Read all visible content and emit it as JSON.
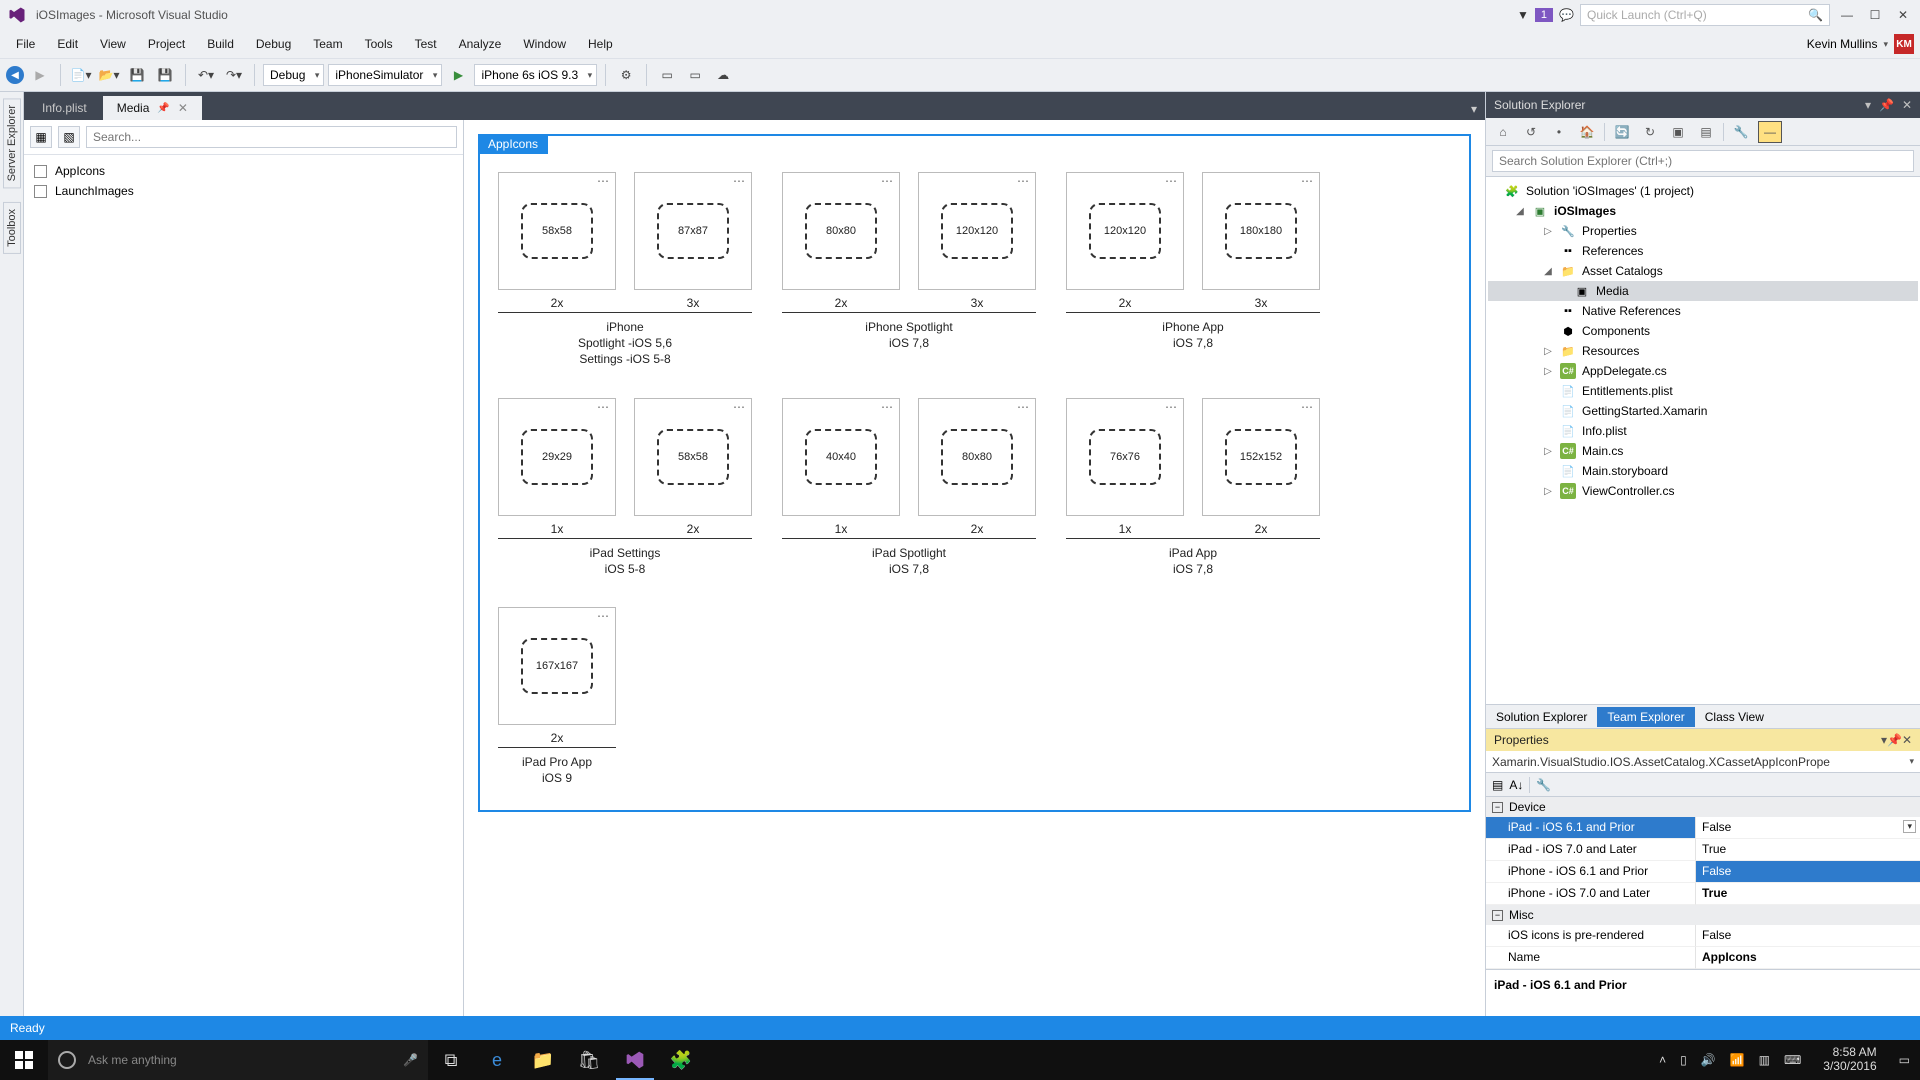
{
  "titlebar": {
    "title": "iOSImages - Microsoft Visual Studio",
    "badge": "1",
    "quick_launch": "Quick Launch (Ctrl+Q)"
  },
  "menubar": {
    "items": [
      "File",
      "Edit",
      "View",
      "Project",
      "Build",
      "Debug",
      "Team",
      "Tools",
      "Test",
      "Analyze",
      "Window",
      "Help"
    ],
    "user": "Kevin Mullins",
    "initials": "KM"
  },
  "toolbar": {
    "config": "Debug",
    "platform": "iPhoneSimulator",
    "target": "iPhone 6s iOS 9.3"
  },
  "doc_tabs": [
    {
      "label": "Info.plist",
      "active": false
    },
    {
      "label": "Media",
      "active": true
    }
  ],
  "asset_left": {
    "search_placeholder": "Search...",
    "items": [
      {
        "label": "AppIcons"
      },
      {
        "label": "LaunchImages"
      }
    ]
  },
  "asset_card": {
    "tag": "AppIcons",
    "groups": [
      {
        "caption": "iPhone\nSpotlight -iOS 5,6\nSettings -iOS 5-8",
        "slots": [
          {
            "size": "58x58",
            "scale": "2x"
          },
          {
            "size": "87x87",
            "scale": "3x"
          }
        ]
      },
      {
        "caption": "iPhone Spotlight\niOS 7,8",
        "slots": [
          {
            "size": "80x80",
            "scale": "2x"
          },
          {
            "size": "120x120",
            "scale": "3x"
          }
        ]
      },
      {
        "caption": "iPhone App\niOS 7,8",
        "slots": [
          {
            "size": "120x120",
            "scale": "2x"
          },
          {
            "size": "180x180",
            "scale": "3x"
          }
        ]
      },
      {
        "caption": "iPad Settings\niOS 5-8",
        "slots": [
          {
            "size": "29x29",
            "scale": "1x"
          },
          {
            "size": "58x58",
            "scale": "2x"
          }
        ]
      },
      {
        "caption": "iPad Spotlight\niOS 7,8",
        "slots": [
          {
            "size": "40x40",
            "scale": "1x"
          },
          {
            "size": "80x80",
            "scale": "2x"
          }
        ]
      },
      {
        "caption": "iPad App\niOS 7,8",
        "slots": [
          {
            "size": "76x76",
            "scale": "1x"
          },
          {
            "size": "152x152",
            "scale": "2x"
          }
        ]
      },
      {
        "caption": "iPad Pro App\niOS 9",
        "slots": [
          {
            "size": "167x167",
            "scale": "2x"
          }
        ]
      }
    ]
  },
  "solution_explorer": {
    "title": "Solution Explorer",
    "search_placeholder": "Search Solution Explorer (Ctrl+;)",
    "root": "Solution 'iOSImages' (1 project)",
    "project": "iOSImages",
    "nodes": [
      {
        "label": "Properties",
        "indent": 3,
        "exp": "▷",
        "icon": "wrench"
      },
      {
        "label": "References",
        "indent": 3,
        "exp": "",
        "icon": "ref"
      },
      {
        "label": "Asset Catalogs",
        "indent": 3,
        "exp": "◢",
        "icon": "folder-cat"
      },
      {
        "label": "Media",
        "indent": 4,
        "exp": "",
        "icon": "media",
        "selected": true
      },
      {
        "label": "Native References",
        "indent": 3,
        "exp": "",
        "icon": "ref"
      },
      {
        "label": "Components",
        "indent": 3,
        "exp": "",
        "icon": "comp"
      },
      {
        "label": "Resources",
        "indent": 3,
        "exp": "▷",
        "icon": "folder"
      },
      {
        "label": "AppDelegate.cs",
        "indent": 3,
        "exp": "▷",
        "icon": "cs"
      },
      {
        "label": "Entitlements.plist",
        "indent": 3,
        "exp": "",
        "icon": "file"
      },
      {
        "label": "GettingStarted.Xamarin",
        "indent": 3,
        "exp": "",
        "icon": "file"
      },
      {
        "label": "Info.plist",
        "indent": 3,
        "exp": "",
        "icon": "file"
      },
      {
        "label": "Main.cs",
        "indent": 3,
        "exp": "▷",
        "icon": "cs"
      },
      {
        "label": "Main.storyboard",
        "indent": 3,
        "exp": "",
        "icon": "file"
      },
      {
        "label": "ViewController.cs",
        "indent": 3,
        "exp": "▷",
        "icon": "cs"
      }
    ],
    "tabs": [
      "Solution Explorer",
      "Team Explorer",
      "Class View"
    ]
  },
  "properties": {
    "title": "Properties",
    "object": "Xamarin.VisualStudio.IOS.AssetCatalog.XCassetAppIconPrope",
    "cat_device": "Device",
    "device_rows": [
      {
        "name": "iPad - iOS 6.1 and Prior",
        "value": "False",
        "sel_name": true,
        "dd": true
      },
      {
        "name": "iPad - iOS 7.0 and Later",
        "value": "True"
      },
      {
        "name": "iPhone - iOS 6.1 and Prior",
        "value": "False",
        "sel_val": true
      },
      {
        "name": "iPhone - iOS 7.0 and Later",
        "value": "True",
        "bold": true
      }
    ],
    "cat_misc": "Misc",
    "misc_rows": [
      {
        "name": "iOS icons is pre-rendered",
        "value": "False"
      },
      {
        "name": "Name",
        "value": "AppIcons",
        "bold": true
      }
    ],
    "desc": "iPad - iOS 6.1 and Prior"
  },
  "side_tabs": [
    "Server Explorer",
    "Toolbox"
  ],
  "statusbar": {
    "text": "Ready"
  },
  "taskbar": {
    "search": "Ask me anything",
    "time": "8:58 AM",
    "date": "3/30/2016"
  }
}
